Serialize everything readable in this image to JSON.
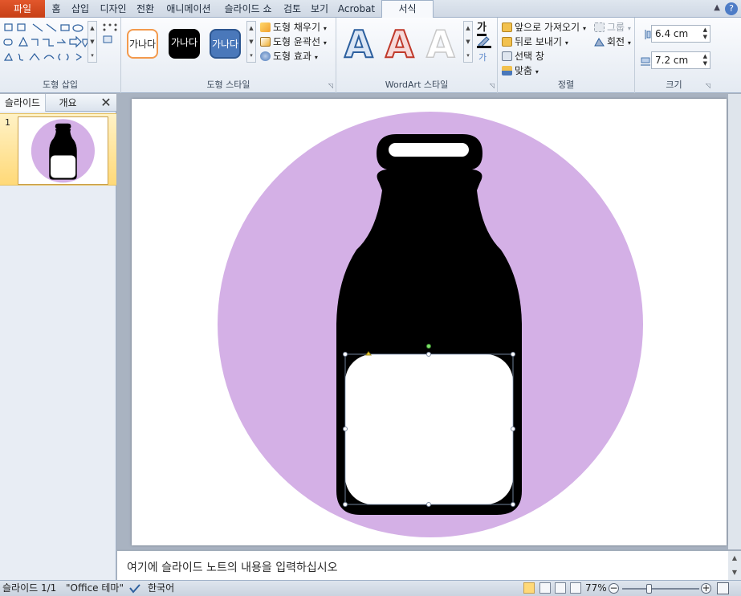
{
  "tabs": {
    "file": "파일",
    "home": "홈",
    "insert": "삽입",
    "design": "디자인",
    "transitions": "전환",
    "animations": "애니메이션",
    "slideshow": "슬라이드 쇼",
    "review": "검토",
    "view": "보기",
    "acrobat": "Acrobat",
    "format": "서식"
  },
  "ribbon": {
    "insert_shapes_label": "도형 삽입",
    "shape_styles_label": "도형 스타일",
    "shape_style_sample": "가나다",
    "shape_fill": "도형 채우기",
    "shape_outline": "도형 윤곽선",
    "shape_effects": "도형 효과",
    "wordart_label": "WordArt 스타일",
    "wordart_sample": "A",
    "text_fill_glyph": "가",
    "arrange_label": "정렬",
    "bring_forward": "앞으로 가져오기",
    "send_backward": "뒤로 보내기",
    "selection_pane": "선택 창",
    "align": "맞춤",
    "group": "그룹",
    "rotate": "회전",
    "size_label": "크기",
    "height_value": "6.4 cm",
    "width_value": "7.2 cm"
  },
  "panel": {
    "slides_tab": "슬라이드",
    "outline_tab": "개요",
    "close": "✕",
    "slide_number": "1"
  },
  "notes": {
    "placeholder": "여기에 슬라이드 노트의 내용을 입력하십시오"
  },
  "status": {
    "slide_count": "슬라이드 1/1",
    "theme": "\"Office 테마\"",
    "language": "한국어",
    "zoom": "77%"
  },
  "colors": {
    "accent_file": "#d2491d",
    "circle": "#d4b0e6",
    "bottle": "#000000",
    "label": "#ffffff"
  }
}
